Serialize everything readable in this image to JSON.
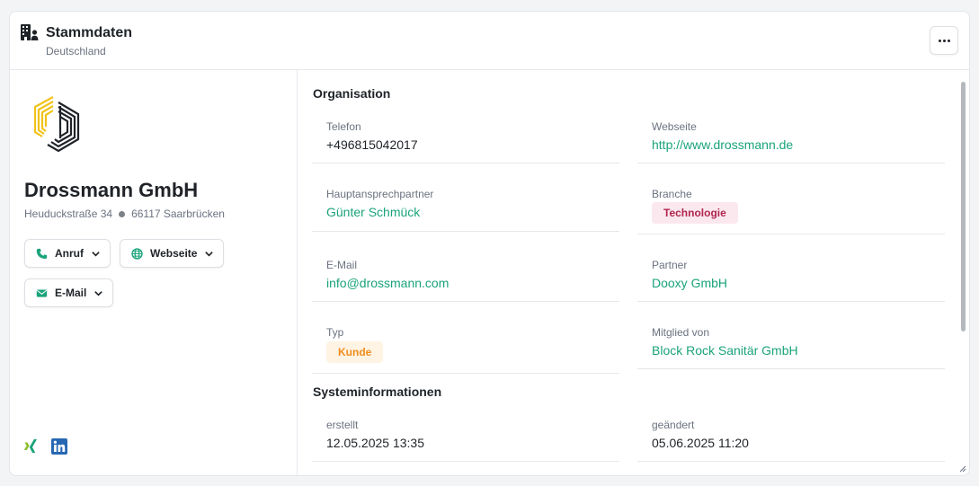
{
  "header": {
    "title": "Stammdaten",
    "subtitle": "Deutschland",
    "icon": "building-user-icon",
    "more_icon": "ellipsis-icon"
  },
  "company": {
    "name": "Drossmann GmbH",
    "street": "Heuduckstraße 34",
    "city": "66117 Saarbrücken",
    "logo_colors": [
      "#f2c318",
      "#1f2328"
    ]
  },
  "actions": [
    {
      "label": "Anruf",
      "icon": "phone-icon"
    },
    {
      "label": "Webseite",
      "icon": "globe-icon"
    },
    {
      "label": "E-Mail",
      "icon": "envelope-icon"
    }
  ],
  "social": [
    {
      "name": "xing-icon"
    },
    {
      "name": "linkedin-icon"
    }
  ],
  "sections": {
    "organisation": "Organisation",
    "system": "Systeminformationen"
  },
  "fields": {
    "telefon": {
      "label": "Telefon",
      "value": "+496815042017"
    },
    "webseite": {
      "label": "Webseite",
      "value": "http://www.drossmann.de"
    },
    "ansprechpartner": {
      "label": "Hauptansprechpartner",
      "value": "Günter Schmück"
    },
    "branche": {
      "label": "Branche",
      "value": "Technologie"
    },
    "email": {
      "label": "E-Mail",
      "value": "info@drossmann.com"
    },
    "partner": {
      "label": "Partner",
      "value": "Dooxy GmbH"
    },
    "typ": {
      "label": "Typ",
      "value": "Kunde"
    },
    "mitglied": {
      "label": "Mitglied von",
      "value": "Block Rock Sanitär GmbH"
    },
    "erstellt": {
      "label": "erstellt",
      "value": "12.05.2025 13:35"
    },
    "geaendert": {
      "label": "geändert",
      "value": "05.06.2025 11:20"
    }
  },
  "colors": {
    "accent": "#1aa37a",
    "badge_tech_bg": "#fbe8ee",
    "badge_tech_fg": "#b0264f",
    "badge_kunde_bg": "#fff3e3",
    "badge_kunde_fg": "#f08c1c"
  }
}
